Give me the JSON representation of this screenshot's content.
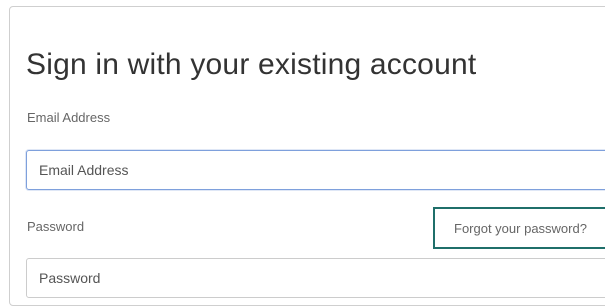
{
  "form": {
    "title": "Sign in with your existing account",
    "email_label": "Email Address",
    "email_placeholder": "Email Address",
    "email_value": "",
    "password_label": "Password",
    "password_placeholder": "Password",
    "password_value": "",
    "forgot_link": "Forgot your password?"
  },
  "colors": {
    "focus_border": "#7ea0dc",
    "highlight_border": "#1f6f6a",
    "text": "#333333",
    "muted_text": "#666666"
  }
}
